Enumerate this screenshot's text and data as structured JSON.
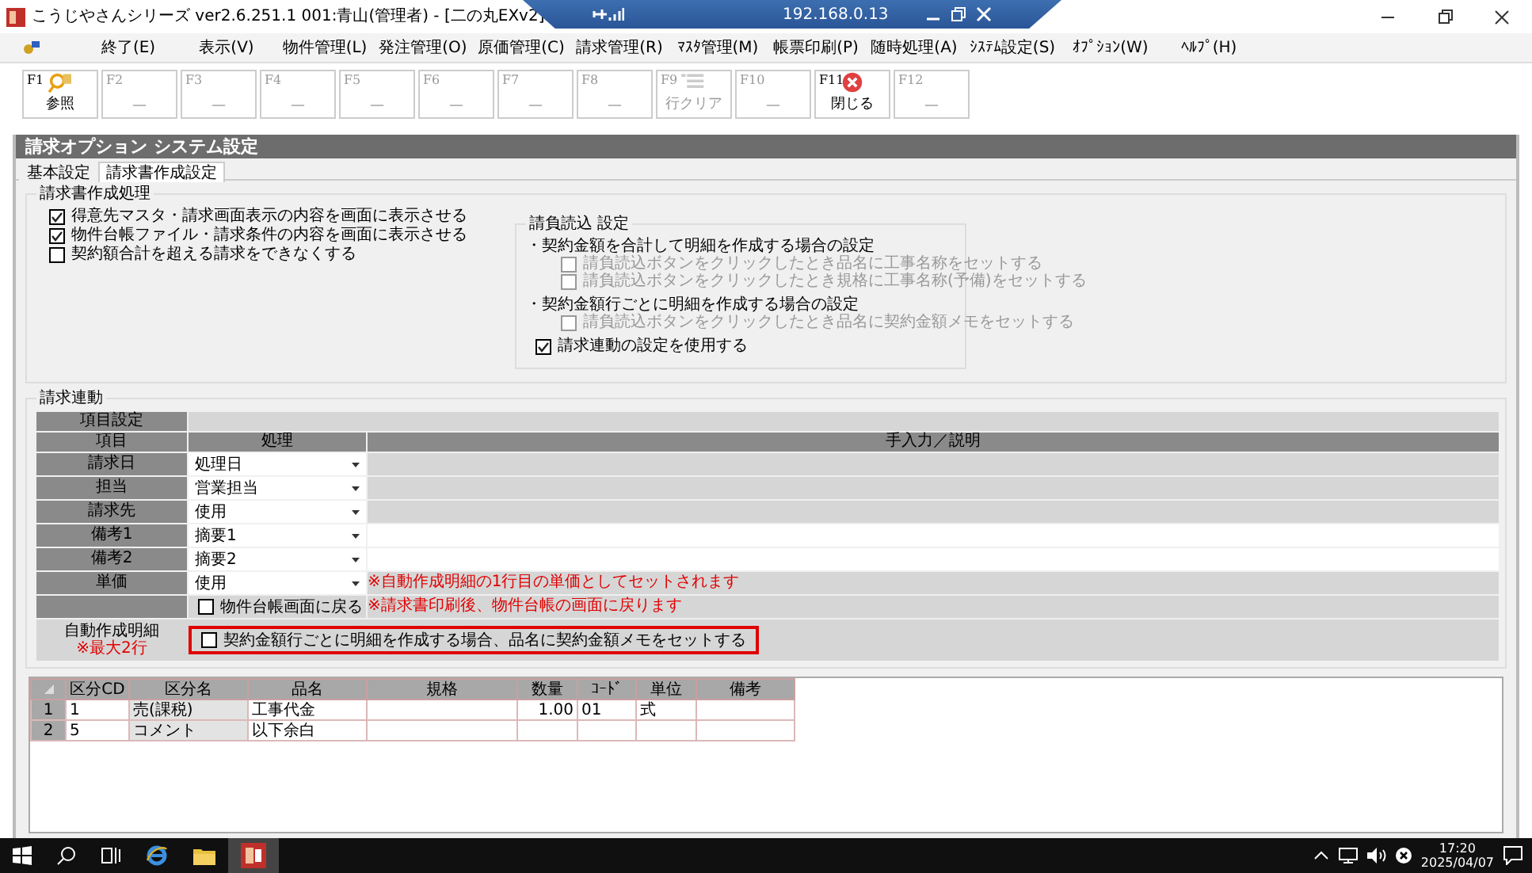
{
  "window": {
    "title": "こうじやさんシリーズ ver2.6.251.1 001:青山(管理者) - [二の丸EXv2]",
    "remote_bar": {
      "address": "192.168.0.13"
    }
  },
  "menu": [
    "終了(E)",
    "表示(V)",
    "物件管理(L)",
    "発注管理(O)",
    "原価管理(C)",
    "請求管理(R)",
    "ﾏｽﾀ管理(M)",
    "帳票印刷(P)",
    "随時処理(A)",
    "ｼｽﾃﾑ設定(S)",
    "ｵﾌﾟｼｮﾝ(W)",
    "ﾍﾙﾌﾟ(H)"
  ],
  "function_keys": [
    {
      "key": "F1",
      "label": "参照",
      "kind": "search",
      "disabled": false
    },
    {
      "key": "F2",
      "label": "—",
      "kind": "empty",
      "disabled": true
    },
    {
      "key": "F3",
      "label": "—",
      "kind": "empty",
      "disabled": true
    },
    {
      "key": "F4",
      "label": "—",
      "kind": "empty",
      "disabled": true
    },
    {
      "key": "F5",
      "label": "—",
      "kind": "empty",
      "disabled": true
    },
    {
      "key": "F6",
      "label": "—",
      "kind": "empty",
      "disabled": true
    },
    {
      "key": "F7",
      "label": "—",
      "kind": "empty",
      "disabled": true
    },
    {
      "key": "F8",
      "label": "—",
      "kind": "empty",
      "disabled": true
    },
    {
      "key": "F9",
      "label": "行クリア",
      "kind": "clear",
      "disabled": true
    },
    {
      "key": "F10",
      "label": "—",
      "kind": "empty",
      "disabled": true
    },
    {
      "key": "F11",
      "label": "閉じる",
      "kind": "close",
      "disabled": false
    },
    {
      "key": "F12",
      "label": "—",
      "kind": "empty",
      "disabled": true
    }
  ],
  "screen_title": "請求オプション システム設定",
  "tabs": [
    {
      "label": "基本設定",
      "selected": false
    },
    {
      "label": "請求書作成設定",
      "selected": true
    }
  ],
  "invoice_processing": {
    "title": "請求書作成処理",
    "options": [
      {
        "label": "得意先マスタ・請求画面表示の内容を画面に表示させる",
        "checked": true
      },
      {
        "label": "物件台帳ファイル・請求条件の内容を画面に表示させる",
        "checked": true
      },
      {
        "label": "契約額合計を超える請求をできなくする",
        "checked": false
      }
    ],
    "subcontract_import": {
      "title": "請負読込  設定",
      "sections": [
        {
          "heading": "・契約金額を合計して明細を作成する場合の設定",
          "options": [
            {
              "label": "請負読込ボタンをクリックしたとき品名に工事名称をセットする",
              "checked": false,
              "disabled": true
            },
            {
              "label": "請負読込ボタンをクリックしたとき規格に工事名称(予備)をセットする",
              "checked": false,
              "disabled": true
            }
          ]
        },
        {
          "heading": "・契約金額行ごとに明細を作成する場合の設定",
          "options": [
            {
              "label": "請負読込ボタンをクリックしたとき品名に契約金額メモをセットする",
              "checked": false,
              "disabled": true
            }
          ]
        }
      ],
      "use_billing_link": {
        "label": "請求連動の設定を使用する",
        "checked": true
      }
    }
  },
  "billing_link": {
    "title": "請求連動",
    "group_header": "項目設定",
    "columns": [
      "項目",
      "処理",
      "手入力／説明"
    ],
    "rows": [
      {
        "item": "請求日",
        "value": "処理日",
        "editable": false
      },
      {
        "item": "担当",
        "value": "営業担当",
        "editable": false
      },
      {
        "item": "請求先",
        "value": "使用",
        "editable": false
      },
      {
        "item": "備考1",
        "value": "摘要1",
        "editable": true
      },
      {
        "item": "備考2",
        "value": "摘要2",
        "editable": true
      },
      {
        "item": "単価",
        "value": "使用",
        "editable": false,
        "note": "※自動作成明細の1行目の単価としてセットされます"
      }
    ],
    "return_option": {
      "label": "物件台帳画面に戻る",
      "checked": false,
      "note": "※請求書印刷後、物件台帳の画面に戻ります"
    },
    "auto_detail": {
      "label": "自動作成明細",
      "sublabel": "※最大2行",
      "option": {
        "label": "契約金額行ごとに明細を作成する場合、品名に契約金額メモをセットする",
        "checked": false,
        "highlighted": true
      }
    }
  },
  "details": {
    "columns": [
      "区分CD",
      "区分名",
      "品名",
      "規格",
      "数量",
      "ｺｰﾄﾞ",
      "単位",
      "備考"
    ],
    "rows": [
      {
        "number": "1",
        "cells": [
          "1",
          "売(課税)",
          "工事代金",
          "",
          "1.00",
          "01",
          "式",
          ""
        ]
      },
      {
        "number": "2",
        "cells": [
          "5",
          "コメント",
          "以下余白",
          "",
          "",
          "",
          "",
          ""
        ]
      }
    ]
  },
  "taskbar": {
    "time": "17:20",
    "date": "2025/04/07"
  }
}
